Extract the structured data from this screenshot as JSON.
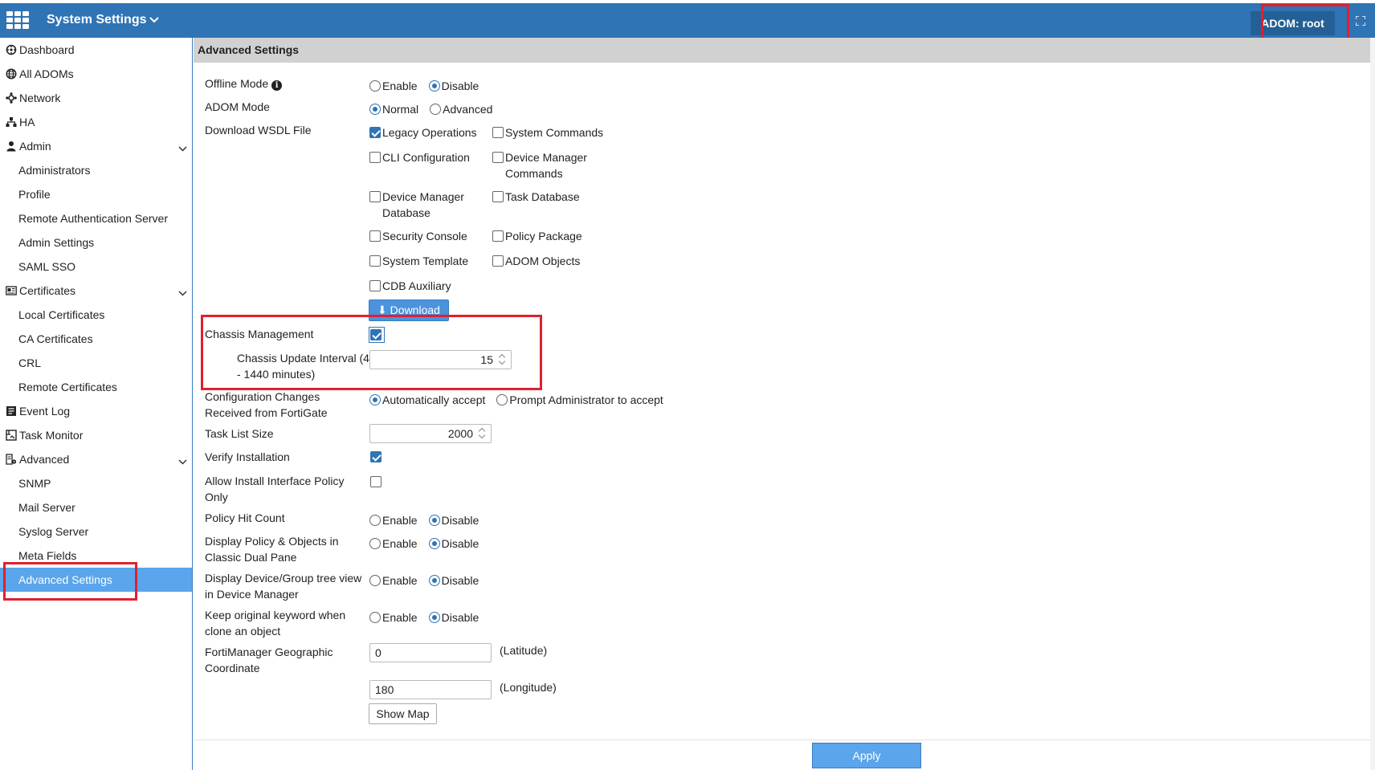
{
  "header": {
    "title": "System Settings",
    "adom": "ADOM: root"
  },
  "sidebar": {
    "items": [
      {
        "label": "Dashboard",
        "icon": "dashboard-icon",
        "level": 0
      },
      {
        "label": "All ADOMs",
        "icon": "globe-icon",
        "level": 0
      },
      {
        "label": "Network",
        "icon": "network-icon",
        "level": 0
      },
      {
        "label": "HA",
        "icon": "ha-icon",
        "level": 0
      },
      {
        "label": "Admin",
        "icon": "user-icon",
        "level": 0,
        "expanded": true
      },
      {
        "label": "Administrators",
        "level": 1
      },
      {
        "label": "Profile",
        "level": 1
      },
      {
        "label": "Remote Authentication Server",
        "level": 1
      },
      {
        "label": "Admin Settings",
        "level": 1
      },
      {
        "label": "SAML SSO",
        "level": 1
      },
      {
        "label": "Certificates",
        "icon": "certificate-icon",
        "level": 0,
        "expanded": true
      },
      {
        "label": "Local Certificates",
        "level": 1
      },
      {
        "label": "CA Certificates",
        "level": 1
      },
      {
        "label": "CRL",
        "level": 1
      },
      {
        "label": "Remote Certificates",
        "level": 1
      },
      {
        "label": "Event Log",
        "icon": "event-log-icon",
        "level": 0
      },
      {
        "label": "Task Monitor",
        "icon": "task-monitor-icon",
        "level": 0
      },
      {
        "label": "Advanced",
        "icon": "advanced-icon",
        "level": 0,
        "expanded": true
      },
      {
        "label": "SNMP",
        "level": 1
      },
      {
        "label": "Mail Server",
        "level": 1
      },
      {
        "label": "Syslog Server",
        "level": 1
      },
      {
        "label": "Meta Fields",
        "level": 1
      },
      {
        "label": "Advanced Settings",
        "level": 1,
        "active": true
      }
    ]
  },
  "main": {
    "section_title": "Advanced Settings",
    "offline_mode": {
      "label": "Offline Mode",
      "options": [
        "Enable",
        "Disable"
      ],
      "selected": "Disable"
    },
    "adom_mode": {
      "label": "ADOM Mode",
      "options": [
        "Normal",
        "Advanced"
      ],
      "selected": "Normal"
    },
    "wsdl": {
      "label": "Download WSDL File",
      "items": [
        {
          "label": "Legacy Operations",
          "checked": true
        },
        {
          "label": "System Commands",
          "checked": false
        },
        {
          "label": "CLI Configuration",
          "checked": false
        },
        {
          "label": "Device Manager Commands",
          "checked": false
        },
        {
          "label": "Device Manager Database",
          "checked": false
        },
        {
          "label": "Task Database",
          "checked": false
        },
        {
          "label": "Security Console",
          "checked": false
        },
        {
          "label": "Policy Package",
          "checked": false
        },
        {
          "label": "System Template",
          "checked": false
        },
        {
          "label": "ADOM Objects",
          "checked": false
        },
        {
          "label": "CDB Auxiliary",
          "checked": false
        }
      ],
      "download_label": "Download"
    },
    "chassis_management": {
      "label": "Chassis Management",
      "checked": true
    },
    "chassis_interval": {
      "label": "Chassis Update Interval (4 - 1440 minutes)",
      "value": "15"
    },
    "config_changes": {
      "label": "Configuration Changes Received from FortiGate",
      "options": [
        "Automatically accept",
        "Prompt Administrator to accept"
      ],
      "selected": "Automatically accept"
    },
    "task_list_size": {
      "label": "Task List Size",
      "value": "2000"
    },
    "verify_installation": {
      "label": "Verify Installation",
      "checked": true
    },
    "allow_install": {
      "label": "Allow Install Interface Policy Only",
      "checked": false
    },
    "policy_hit_count": {
      "label": "Policy Hit Count",
      "options": [
        "Enable",
        "Disable"
      ],
      "selected": "Disable"
    },
    "display_policy": {
      "label": "Display Policy & Objects in Classic Dual Pane",
      "options": [
        "Enable",
        "Disable"
      ],
      "selected": "Disable"
    },
    "display_device": {
      "label": "Display Device/Group tree view in Device Manager",
      "options": [
        "Enable",
        "Disable"
      ],
      "selected": "Disable"
    },
    "keep_keyword": {
      "label": "Keep original keyword when clone an object",
      "options": [
        "Enable",
        "Disable"
      ],
      "selected": "Disable"
    },
    "geo": {
      "label": "FortiManager Geographic Coordinate",
      "latitude": "0",
      "latitude_label": "(Latitude)",
      "longitude": "180",
      "longitude_label": "(Longitude)",
      "show_map_label": "Show Map"
    },
    "apply_label": "Apply"
  },
  "colors": {
    "header": "#2f74b5",
    "active": "#5aa5eb",
    "highlight": "#e0202e"
  }
}
